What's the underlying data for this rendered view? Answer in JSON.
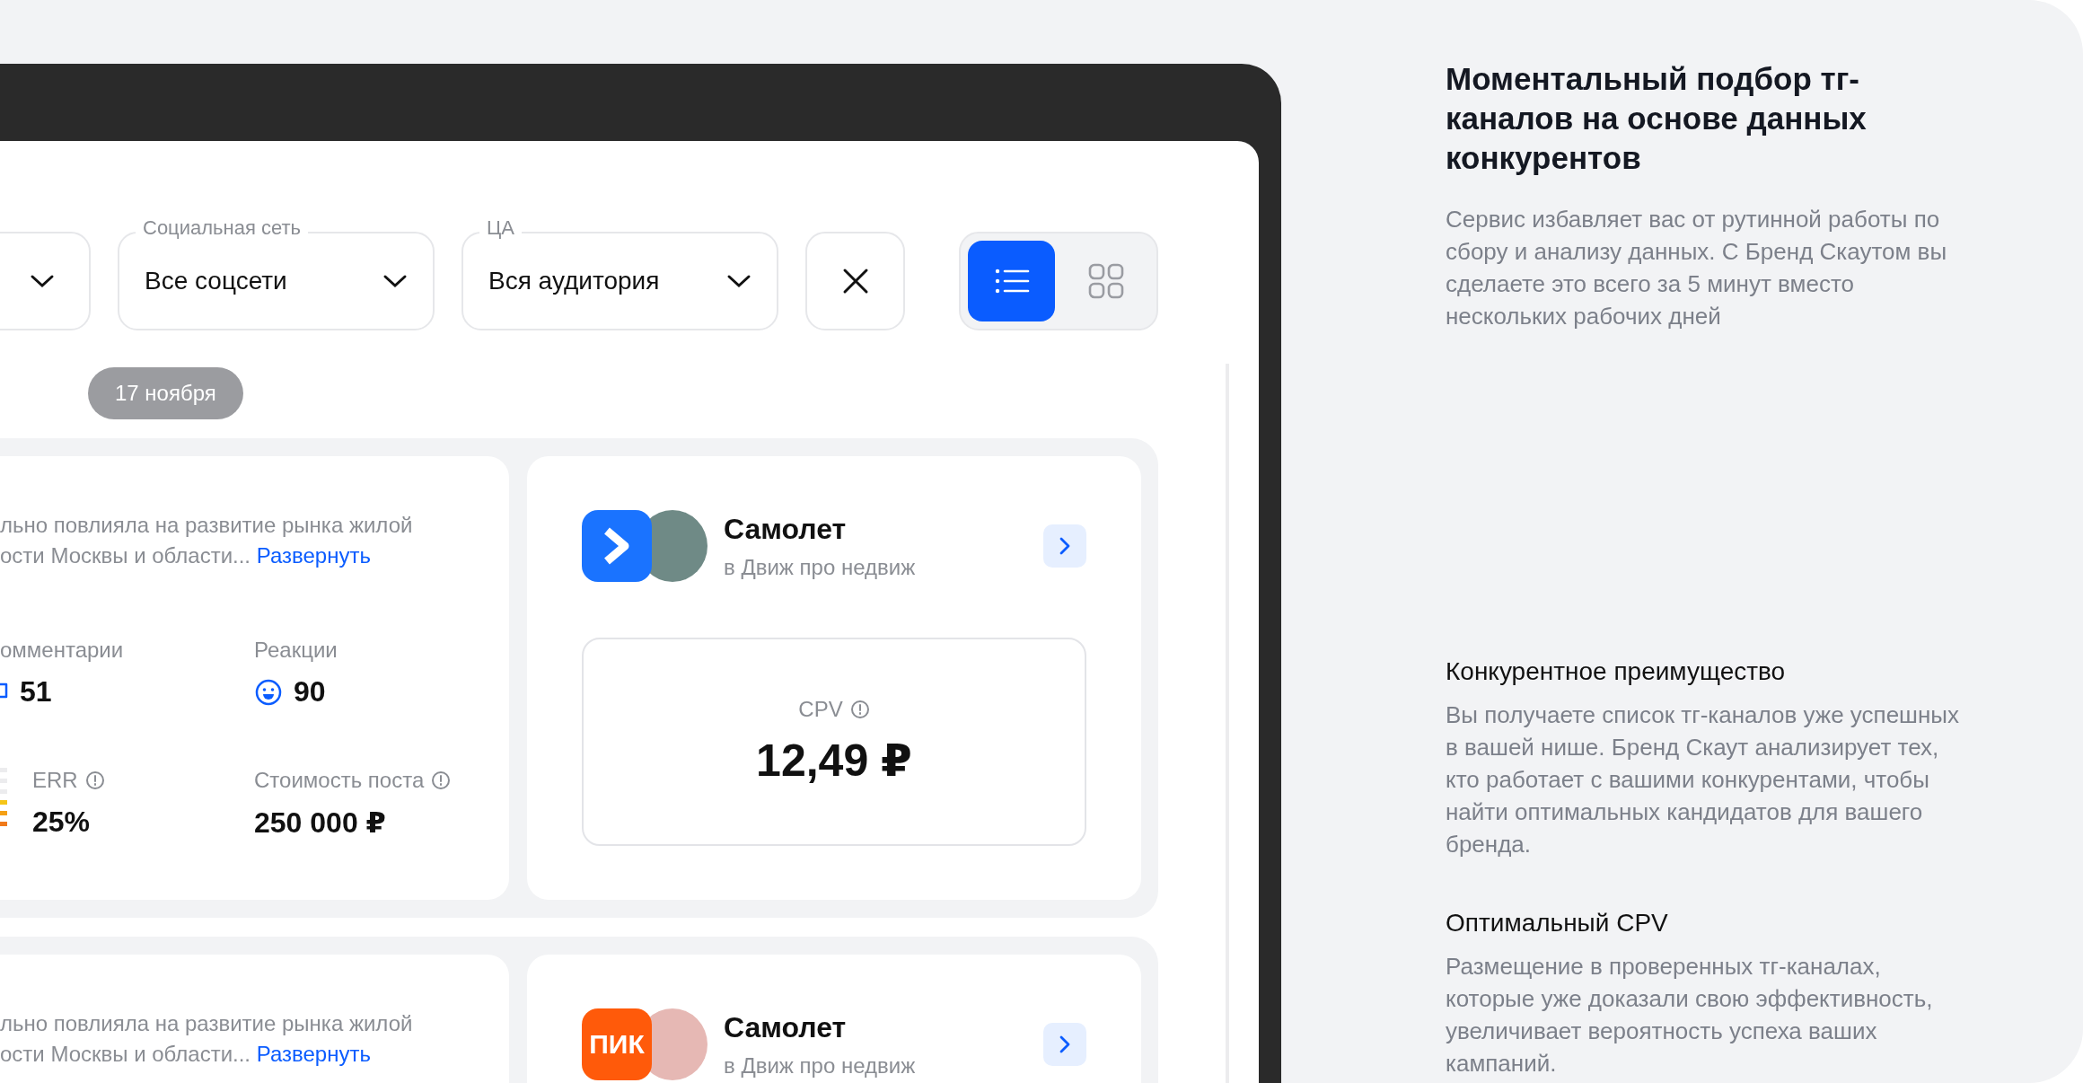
{
  "filters": [
    {
      "label": "Социальная сеть",
      "value": "Все соцсети"
    },
    {
      "label": "ЦА",
      "value": "Вся аудитория"
    }
  ],
  "view_toggle": [
    {
      "kind": "list",
      "selected": true
    },
    {
      "kind": "grid",
      "selected": false
    }
  ],
  "date_badge": "17 ноября",
  "posts": [
    {
      "text_lines": [
        "льно повлияла на развитие рынка жилой",
        "ости Москвы и области..."
      ],
      "more_link": "Развернуть",
      "stats": [
        {
          "kind": "comments",
          "label": "омментарии",
          "value": "51"
        },
        {
          "kind": "reactions",
          "label": "Реакции",
          "value": "90"
        },
        {
          "kind": "err",
          "label": "ERR",
          "value": "25%",
          "info": true
        },
        {
          "kind": "cost",
          "label": "Стоимость поста",
          "value": "250 000 ₽",
          "info": true
        }
      ],
      "channel": {
        "kind": "arrow",
        "name": "Самолет",
        "subtitle": "в Движ про недвиж"
      },
      "metric": {
        "label": "CPV",
        "value": "12,49 ₽",
        "info": true
      }
    },
    {
      "text_lines": [
        "льно повлияла на развитие рынка жилой",
        "ости Москвы и области..."
      ],
      "more_link": "Развернуть",
      "channel": {
        "kind": "text",
        "logo_text": "ПИК",
        "name": "Самолет",
        "subtitle": "в Движ про недвиж"
      }
    }
  ],
  "info": {
    "title": "Моментальный подбор тг-каналов на основе данных конкурентов",
    "text": "Сервис избавляет вас от рутинной работы по сбору и анализу данных. С Бренд Скаутом вы сделаете это всего за 5 минут вместо нескольких рабочих дней",
    "sections": [
      {
        "title": "Конкурентное преимущество",
        "text": "Вы получаете список тг-каналов уже успешных в вашей нише. Бренд Скаут анализирует тех, кто работает с вашими конкурентами, чтобы найти оптимальных кандидатов для вашего бренда."
      },
      {
        "title": "Оптимальный CPV",
        "text": "Размещение в проверенных тг-каналах, которые уже доказали свою эффективность, увеличивает вероятность успеха ваших кампаний."
      }
    ]
  }
}
